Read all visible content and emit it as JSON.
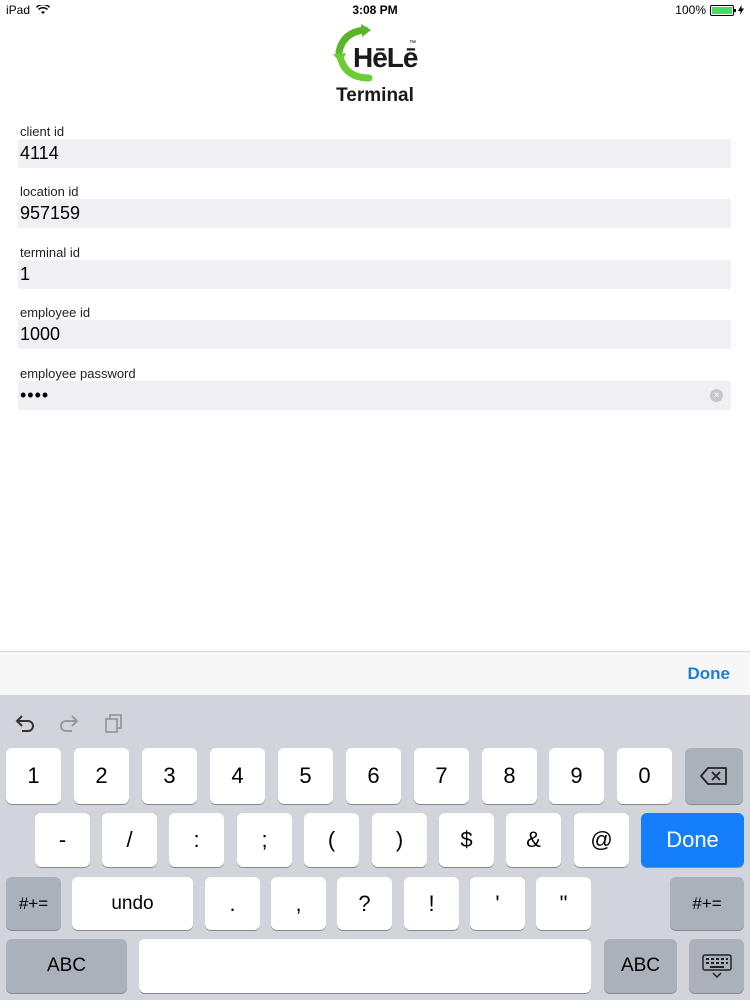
{
  "status_bar": {
    "device": "iPad",
    "time": "3:08 PM",
    "battery": "100%",
    "wifi_icon": "wifi-icon",
    "charging_icon": "bolt-icon"
  },
  "logo": {
    "brand": "HēLē",
    "tm": "™",
    "subtitle": "Terminal",
    "arrow_color": "#5ab52a"
  },
  "form": {
    "fields": [
      {
        "label": "client id",
        "value": "4114"
      },
      {
        "label": "location id",
        "value": "957159"
      },
      {
        "label": "terminal id",
        "value": "1"
      },
      {
        "label": "employee id",
        "value": "1000"
      },
      {
        "label": "employee password",
        "value": "••••"
      }
    ]
  },
  "accessory": {
    "done_label": "Done",
    "done_color": "#1a7fd6"
  },
  "keyboard": {
    "toolbar": [
      "undo-icon",
      "redo-icon",
      "paste-icon"
    ],
    "row1": [
      "1",
      "2",
      "3",
      "4",
      "5",
      "6",
      "7",
      "8",
      "9",
      "0"
    ],
    "row2": [
      "-",
      "/",
      ":",
      ";",
      "(",
      ")",
      "$",
      "&",
      "@"
    ],
    "row2_done": "Done",
    "row3_left": "#+=",
    "row3_undo": "undo",
    "row3": [
      ".",
      ",",
      "?",
      "!",
      "'",
      "\""
    ],
    "row3_right": "#+=",
    "row4_left": "ABC",
    "row4_right": "ABC",
    "done_color": "#147efb"
  }
}
